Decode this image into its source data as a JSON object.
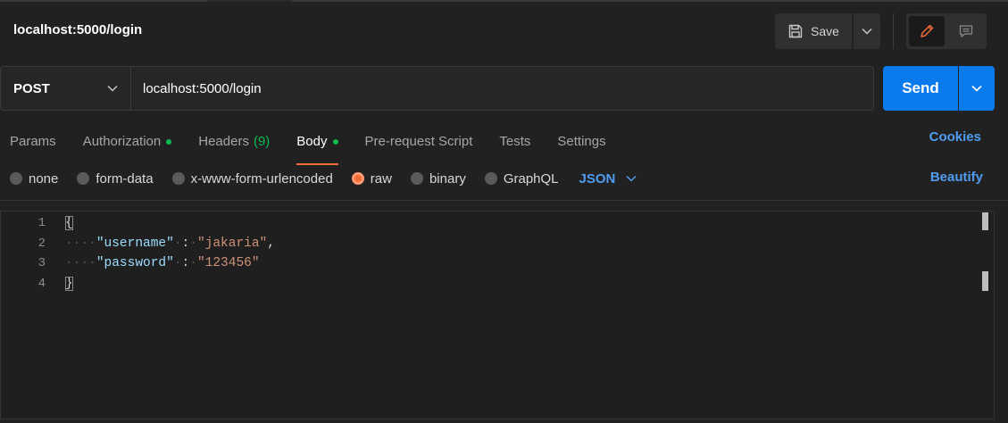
{
  "request": {
    "title": "localhost:5000/login",
    "method": "POST",
    "url": "localhost:5000/login"
  },
  "toolbar": {
    "save_label": "Save",
    "save_icon": "floppy-disk-icon",
    "edit_icon": "pencil-icon",
    "comments_icon": "comment-icon"
  },
  "send": {
    "label": "Send"
  },
  "tabs": [
    {
      "label": "Params"
    },
    {
      "label": "Authorization"
    },
    {
      "label": "Headers",
      "count": "(9)"
    },
    {
      "label": "Body"
    },
    {
      "label": "Pre-request Script"
    },
    {
      "label": "Tests"
    },
    {
      "label": "Settings"
    }
  ],
  "cookies_label": "Cookies",
  "body_types": [
    {
      "label": "none"
    },
    {
      "label": "form-data"
    },
    {
      "label": "x-www-form-urlencoded"
    },
    {
      "label": "raw"
    },
    {
      "label": "binary"
    },
    {
      "label": "GraphQL"
    }
  ],
  "selected_language": "JSON",
  "beautify_label": "Beautify",
  "editor": {
    "line_numbers": [
      "1",
      "2",
      "3",
      "4"
    ],
    "open_brace": "{",
    "close_brace": "}",
    "fields": [
      {
        "key": "\"username\"",
        "value": "\"jakaria\""
      },
      {
        "key": "\"password\"",
        "value": "\"123456\""
      }
    ]
  },
  "colors": {
    "accent": "#097bed",
    "active_tab_underline": "#f26b3a",
    "indicator_dot": "#0cbb52",
    "link": "#4f9cf0"
  }
}
